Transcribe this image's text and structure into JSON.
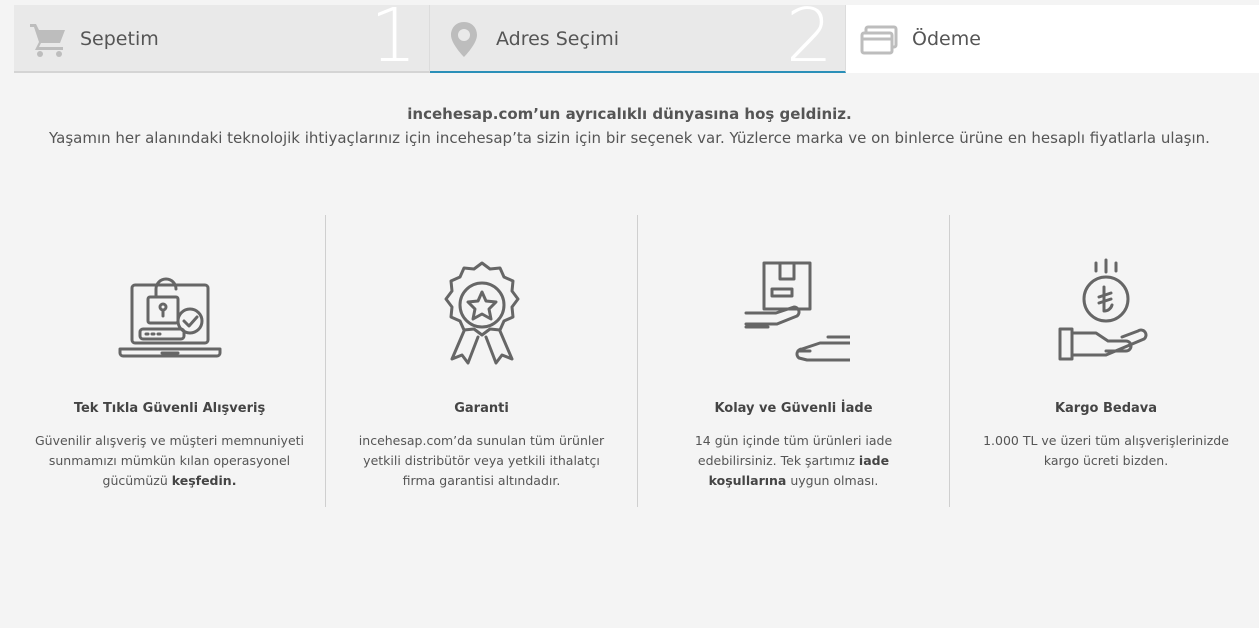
{
  "steps": [
    {
      "label": "Sepetim",
      "number": "1",
      "icon": "cart-icon"
    },
    {
      "label": "Adres Seçimi",
      "number": "2",
      "icon": "location-pin-icon"
    },
    {
      "label": "Ödeme",
      "number": "",
      "icon": "payment-card-icon"
    }
  ],
  "welcome": {
    "title": "incehesap.com’un ayrıcalıklı dünyasına hoş geldiniz.",
    "subtitle": "Yaşamın her alanındaki teknolojik ihtiyaçlarınız için incehesap’ta sizin için bir seçenek var. Yüzlerce marka ve on binlerce ürüne en hesaplı fiyatlarla ulaşın."
  },
  "features": [
    {
      "icon": "secure-laptop-icon",
      "title": "Tek Tıkla Güvenli Alışveriş",
      "desc": "Güvenilir alışveriş ve müşteri memnuniyeti sunmamızı mümkün kılan operasyonel gücümüzü ",
      "link": "keşfedin.",
      "desc_after": ""
    },
    {
      "icon": "award-badge-icon",
      "title": "Garanti",
      "desc": "incehesap.com’da sunulan tüm ürünler yetkili distribütör veya yetkili ithalatçı firma garantisi altındadır.",
      "link": "",
      "desc_after": ""
    },
    {
      "icon": "package-return-icon",
      "title": "Kolay ve Güvenli İade",
      "desc": "14 gün içinde tüm ürünleri iade edebilirsiniz. Tek şartımız ",
      "link": "iade koşullarına",
      "desc_after": " uygun olması."
    },
    {
      "icon": "coin-hand-icon",
      "title": "Kargo Bedava",
      "desc": "1.000 TL ve üzeri tüm alışverişlerinizde kargo ücreti bizden.",
      "link": "",
      "desc_after": ""
    }
  ],
  "colors": {
    "active_step_underline": "#2a8fb8",
    "icon_stroke": "#666666"
  }
}
